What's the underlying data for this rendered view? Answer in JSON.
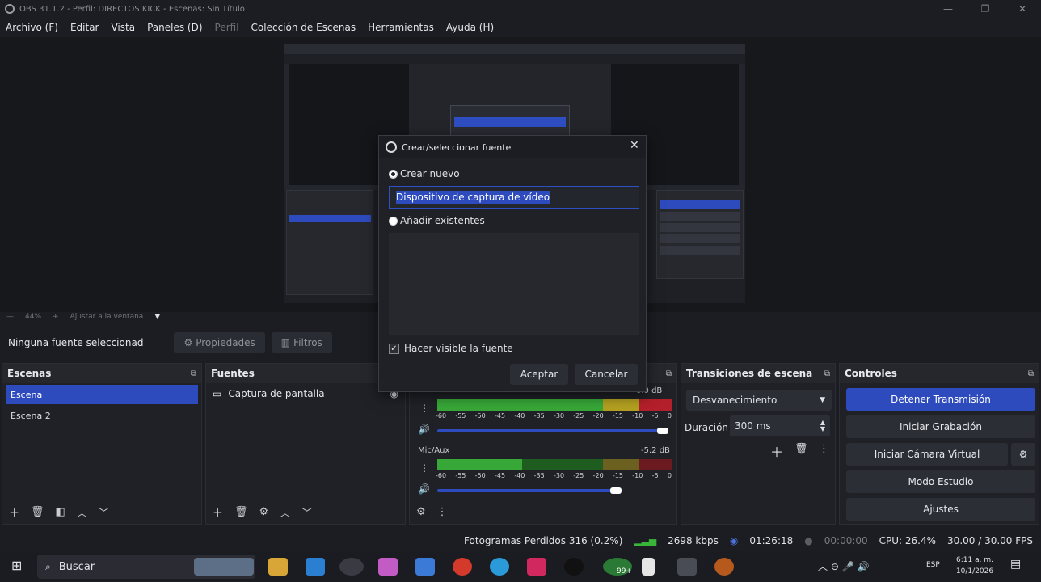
{
  "window": {
    "title": "OBS 31.1.2 - Perfil: DIRECTOS KICK - Escenas: Sin Título",
    "minimize": "—",
    "maximize": "❐",
    "close": "✕"
  },
  "menu": {
    "items": [
      "Archivo (F)",
      "Editar",
      "Vista",
      "Paneles (D)",
      "Perfil",
      "Colección de Escenas",
      "Herramientas",
      "Ayuda (H)"
    ]
  },
  "zoom": {
    "minus": "—",
    "value": "44%",
    "plus": "+",
    "fit": "Ajustar a la ventana"
  },
  "source_toolbar": {
    "no_selection": "Ninguna fuente seleccionad",
    "properties": "Propiedades",
    "filters": "Filtros"
  },
  "scenes": {
    "title": "Escenas",
    "items": [
      {
        "label": "Escena",
        "selected": true
      },
      {
        "label": "Escena 2",
        "selected": false
      }
    ]
  },
  "sources": {
    "title": "Fuentes",
    "items": [
      {
        "label": "Captura de pantalla"
      }
    ]
  },
  "mixer": {
    "channels": [
      {
        "name": "",
        "level": "0.0 dB",
        "ticks": [
          "-60",
          "-55",
          "-50",
          "-45",
          "-40",
          "-35",
          "-30",
          "-25",
          "-20",
          "-15",
          "-10",
          "-5",
          "0"
        ],
        "volume": 1.0
      },
      {
        "name": "Mic/Aux",
        "level": "-5.2 dB",
        "ticks": [
          "-60",
          "-55",
          "-50",
          "-45",
          "-40",
          "-35",
          "-30",
          "-25",
          "-20",
          "-15",
          "-10",
          "-5",
          "0"
        ],
        "volume": 0.77
      }
    ]
  },
  "transitions": {
    "title": "Transiciones de escena",
    "selected": "Desvanecimiento",
    "duration_label": "Duración",
    "duration_value": "300 ms"
  },
  "controls": {
    "title": "Controles",
    "stop_stream": "Detener Transmisión",
    "start_recording": "Iniciar Grabación",
    "virtual_cam": "Iniciar Cámara Virtual",
    "studio_mode": "Modo Estudio",
    "settings": "Ajustes"
  },
  "status": {
    "dropped_frames": "Fotogramas Perdidos 316 (0.2%)",
    "bitrate": "2698 kbps",
    "stream_time": "01:26:18",
    "rec_time": "00:00:00",
    "cpu": "CPU: 26.4%",
    "fps": "30.00 / 30.00 FPS"
  },
  "dialog": {
    "title": "Crear/seleccionar fuente",
    "create_new": "Crear nuevo",
    "name_value": "Dispositivo de captura de vídeo",
    "add_existing": "Añadir existentes",
    "make_visible": "Hacer visible la fuente",
    "accept": "Aceptar",
    "cancel": "Cancelar"
  },
  "taskbar": {
    "search": "Buscar",
    "lang": "ESP",
    "time": "6:11 a. m.",
    "date": "10/1/2026",
    "badge": "99+"
  },
  "colors": {
    "accent": "#2d4bbd",
    "background": "#1c1d22",
    "panel": "#1f2127"
  }
}
